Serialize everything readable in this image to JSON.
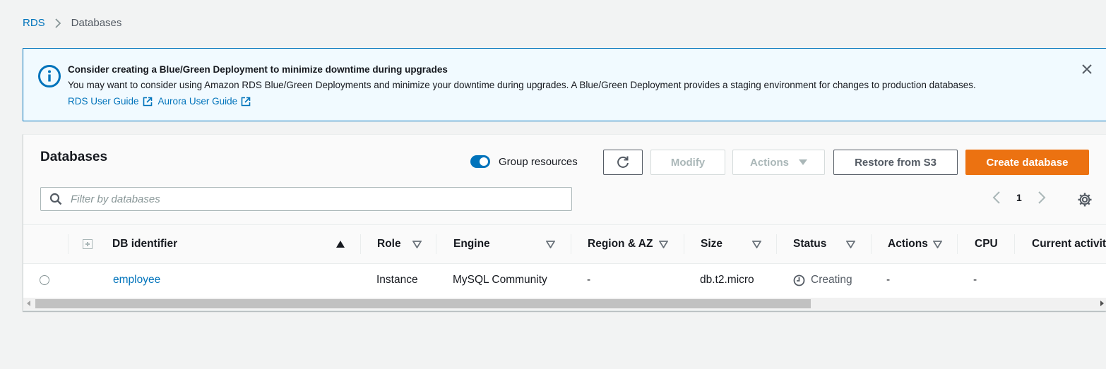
{
  "breadcrumb": {
    "root": "RDS",
    "current": "Databases"
  },
  "flash": {
    "title": "Consider creating a Blue/Green Deployment to minimize downtime during upgrades",
    "message": "You may want to consider using Amazon RDS Blue/Green Deployments and minimize your downtime during upgrades. A Blue/Green Deployment provides a staging environment for changes to production databases.",
    "link1": "RDS User Guide",
    "link2": "Aurora User Guide"
  },
  "panel": {
    "title": "Databases",
    "group_toggle_label": "Group resources",
    "group_toggle_on": true,
    "modify_label": "Modify",
    "actions_label": "Actions",
    "restore_label": "Restore from S3",
    "create_label": "Create database",
    "filter_placeholder": "Filter by databases",
    "page": "1"
  },
  "table": {
    "columns": [
      "DB identifier",
      "Role",
      "Engine",
      "Region & AZ",
      "Size",
      "Status",
      "Actions",
      "CPU",
      "Current activit"
    ],
    "rows": [
      {
        "db_identifier": "employee",
        "role": "Instance",
        "engine": "MySQL Community",
        "region_az": "-",
        "size": "db.t2.micro",
        "status": "Creating",
        "actions": "-",
        "cpu": "-"
      }
    ]
  },
  "colors": {
    "accent": "#0073bb",
    "primary": "#ec7211"
  }
}
